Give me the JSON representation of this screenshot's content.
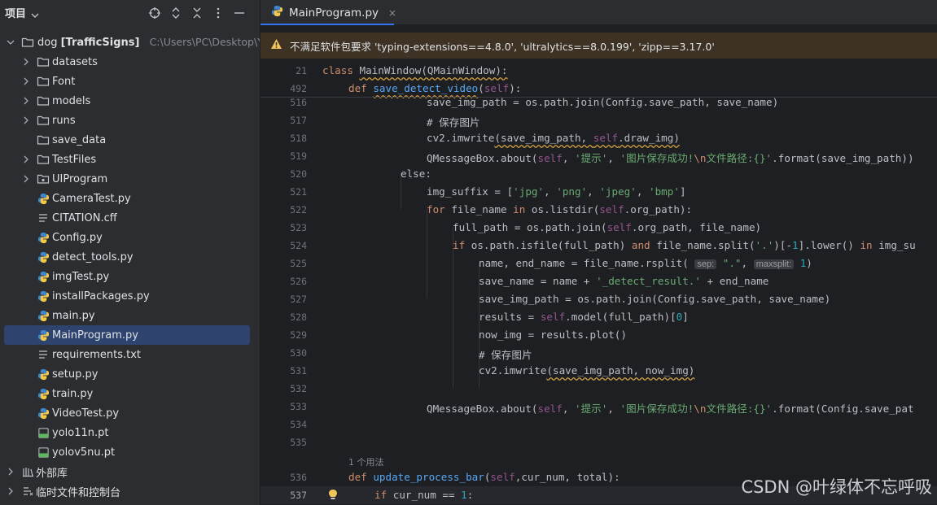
{
  "project_panel": {
    "title": "项目",
    "tools": [
      "crosshair-icon",
      "expand-icon",
      "collapse-icon",
      "more-icon",
      "minimize-icon"
    ],
    "root": {
      "name": "dog",
      "module": "[TrafficSigns]",
      "path": "C:\\Users\\PC\\Desktop\\YC"
    },
    "items": [
      {
        "label": "datasets",
        "type": "folder",
        "expandable": true
      },
      {
        "label": "Font",
        "type": "folder",
        "expandable": true
      },
      {
        "label": "models",
        "type": "folder",
        "expandable": true
      },
      {
        "label": "runs",
        "type": "folder",
        "expandable": true
      },
      {
        "label": "save_data",
        "type": "folder",
        "expandable": false
      },
      {
        "label": "TestFiles",
        "type": "folder",
        "expandable": true
      },
      {
        "label": "UIProgram",
        "type": "package",
        "expandable": true
      },
      {
        "label": "CameraTest.py",
        "type": "python"
      },
      {
        "label": "CITATION.cff",
        "type": "text"
      },
      {
        "label": "Config.py",
        "type": "python"
      },
      {
        "label": "detect_tools.py",
        "type": "python"
      },
      {
        "label": "imgTest.py",
        "type": "python"
      },
      {
        "label": "installPackages.py",
        "type": "python"
      },
      {
        "label": "main.py",
        "type": "python"
      },
      {
        "label": "MainProgram.py",
        "type": "python",
        "selected": true
      },
      {
        "label": "requirements.txt",
        "type": "text"
      },
      {
        "label": "setup.py",
        "type": "python"
      },
      {
        "label": "train.py",
        "type": "python"
      },
      {
        "label": "VideoTest.py",
        "type": "python"
      },
      {
        "label": "yolo11n.pt",
        "type": "model"
      },
      {
        "label": "yolov5nu.pt",
        "type": "model"
      }
    ],
    "external_libraries": "外部库",
    "scratches": "临时文件和控制台"
  },
  "editor": {
    "tab": {
      "label": "MainProgram.py",
      "close": "×"
    },
    "warning": "不满足软件包要求 'typing-extensions==4.8.0', 'ultralytics==8.0.199', 'zipp==3.17.0'",
    "usages_label": "1 个用法",
    "line_numbers": [
      "21",
      "492",
      "516",
      "517",
      "518",
      "519",
      "520",
      "521",
      "522",
      "523",
      "524",
      "525",
      "526",
      "527",
      "528",
      "529",
      "530",
      "531",
      "532",
      "533",
      "534",
      "535",
      "536",
      "537"
    ],
    "code_text": {
      "l21": "class MainWindow(QMainWindow):",
      "l492": "def save_detect_video(self):",
      "l516": "save_img_path = os.path.join(Config.save_path, save_name)",
      "l517": "# 保存图片",
      "l518": "cv2.imwrite(save_img_path, self.draw_img)",
      "l519": "QMessageBox.about(self, '提示', '图片保存成功!\\n文件路径:{}'.format(save_img_path))",
      "l520": "else:",
      "l521": "img_suffix = ['jpg', 'png', 'jpeg', 'bmp']",
      "l522": "for file_name in os.listdir(self.org_path):",
      "l523": "full_path = os.path.join(self.org_path, file_name)",
      "l524": "if os.path.isfile(full_path) and file_name.split('.')[-1].lower() in img_su",
      "l525": "name, end_name = file_name.rsplit(sep: \".\", maxsplit: 1)",
      "l526": "save_name = name + '_detect_result.' + end_name",
      "l527": "save_img_path = os.path.join(Config.save_path, save_name)",
      "l528": "results = self.model(full_path)[0]",
      "l529": "now_img = results.plot()",
      "l530": "# 保存图片",
      "l531": "cv2.imwrite(save_img_path, now_img)",
      "l533": "QMessageBox.about(self, '提示', '图片保存成功!\\n文件路径:{}'.format(Config.save_pat",
      "l536": "def update_process_bar(self,cur_num, total):",
      "l537": "if cur_num == 1:"
    }
  },
  "watermark": "CSDN @叶绿体不忘呼吸",
  "colors": {
    "accent": "#3574f0",
    "warning_bg": "#3d3223",
    "keyword": "#cf8e6d",
    "function": "#56a8f5",
    "string": "#6aab73"
  }
}
